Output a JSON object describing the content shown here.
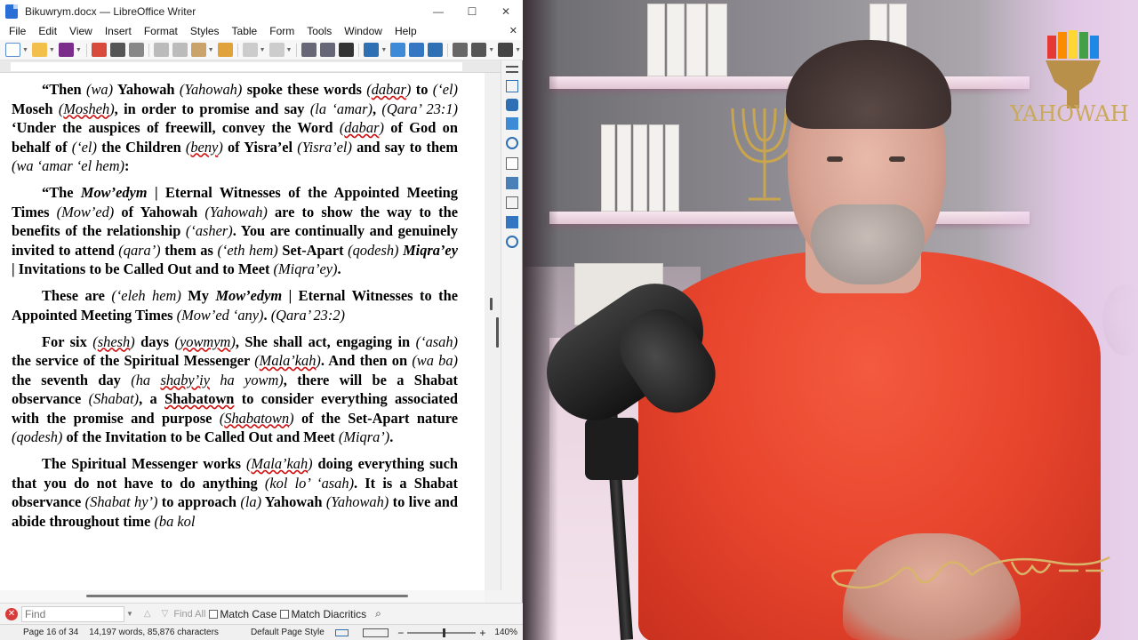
{
  "window": {
    "title": "Bikuwrym.docx — LibreOffice Writer",
    "controls": [
      "—",
      "☐",
      "✕"
    ]
  },
  "menu": [
    "File",
    "Edit",
    "View",
    "Insert",
    "Format",
    "Styles",
    "Table",
    "Form",
    "Tools",
    "Window",
    "Help"
  ],
  "find": {
    "placeholder": "Find",
    "find_all": "Find All",
    "match_case": "Match Case",
    "match_diacritics": "Match Diacritics"
  },
  "status": {
    "page": "Page 16 of 34",
    "words": "14,197 words, 85,876 characters",
    "page_style": "Default Page Style",
    "zoom": "140%"
  },
  "video": {
    "logo_text": "YAHOWAH",
    "signature_text": "Craig Winn"
  }
}
